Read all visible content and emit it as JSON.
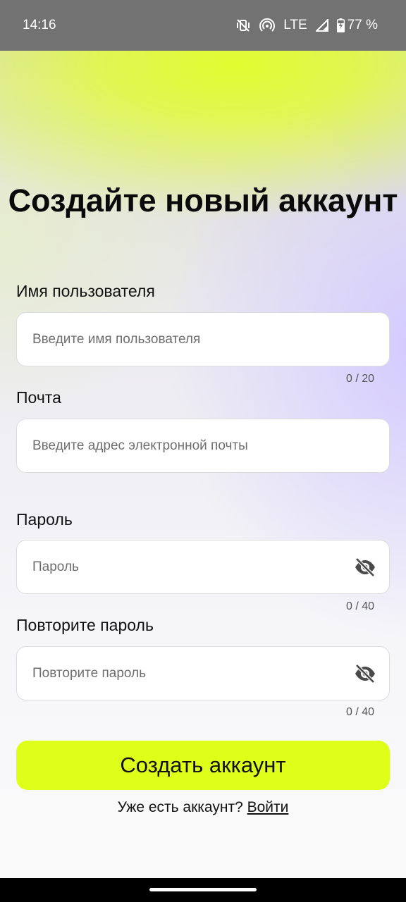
{
  "status_bar": {
    "time": "14:16",
    "network": "LTE",
    "battery": "77 %",
    "icons": [
      "vibrate-off-icon",
      "hotspot-icon",
      "signal-icon",
      "battery-charging-icon"
    ]
  },
  "form": {
    "title": "Создайте новый аккаунт",
    "username": {
      "label": "Имя пользователя",
      "placeholder": "Введите имя пользователя",
      "value": "",
      "counter": "0 / 20"
    },
    "email": {
      "label": "Почта",
      "placeholder": "Введите адрес электронной почты",
      "value": ""
    },
    "password": {
      "label": "Пароль",
      "placeholder": "Пароль",
      "value": "",
      "counter": "0 / 40",
      "toggle_icon": "eye-off-icon"
    },
    "confirm_password": {
      "label": "Повторите пароль",
      "placeholder": "Повторите пароль",
      "value": "",
      "counter": "0 / 40",
      "toggle_icon": "eye-off-icon"
    },
    "submit_label": "Создать аккаунт",
    "login_prompt": "Уже есть аккаунт?",
    "login_link": "Войти"
  },
  "colors": {
    "accent": "#ddff1a",
    "status_bar": "#727272",
    "secondary_gradient": "#d6ceff"
  }
}
